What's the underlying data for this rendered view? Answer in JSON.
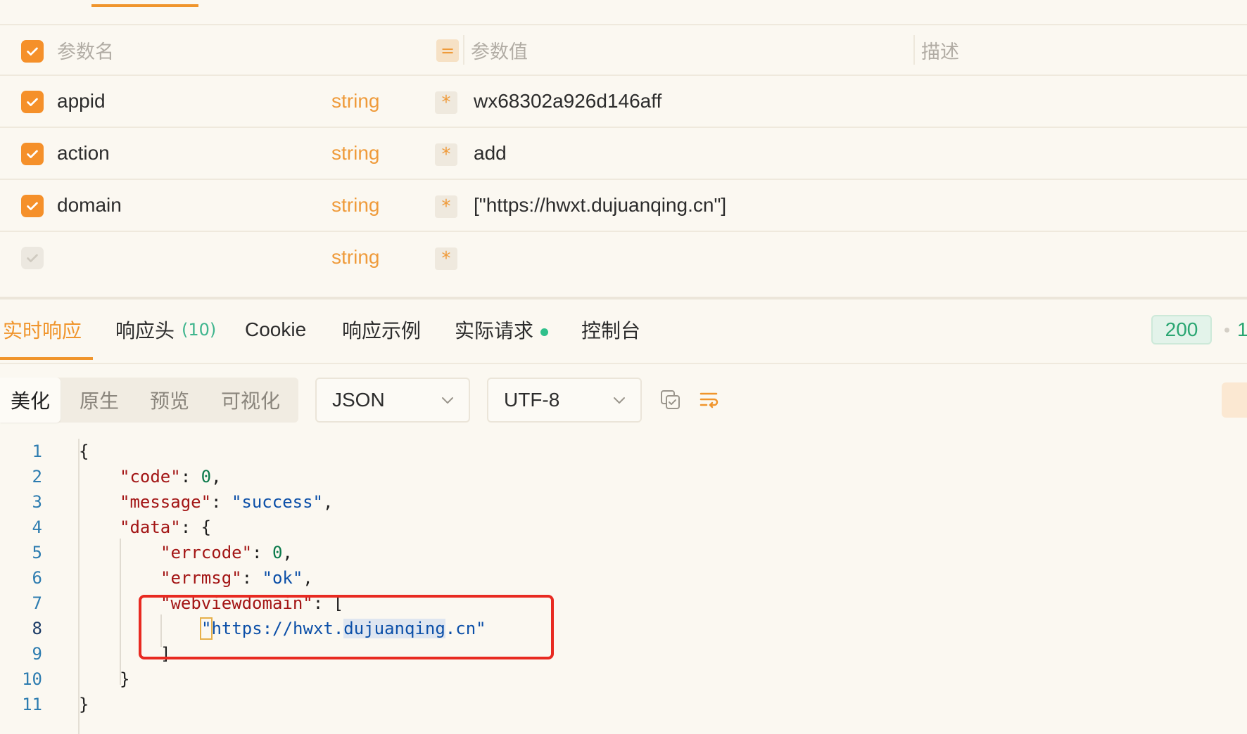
{
  "params": {
    "header": {
      "name": "参数名",
      "value": "参数值",
      "desc": "描述",
      "eq_symbol": "="
    },
    "rows": [
      {
        "name": "appid",
        "type": "string",
        "required": "*",
        "value": "wx68302a926d146aff",
        "checked": true
      },
      {
        "name": "action",
        "type": "string",
        "required": "*",
        "value": "add",
        "checked": true
      },
      {
        "name": "domain",
        "type": "string",
        "required": "*",
        "value": "[\"https://hwxt.dujuanqing.cn\"]",
        "checked": true
      },
      {
        "name": "",
        "type": "string",
        "required": "*",
        "value": "",
        "checked": false
      }
    ]
  },
  "response_tabs": {
    "realtime": "实时响应",
    "headers": "响应头",
    "headers_count": "(10)",
    "cookie": "Cookie",
    "example": "响应示例",
    "actual_request": "实际请求",
    "console": "控制台",
    "status_code": "200",
    "status_more": "1"
  },
  "toolbar": {
    "views": [
      "美化",
      "原生",
      "预览",
      "可视化"
    ],
    "active_view": "美化",
    "format": "JSON",
    "encoding": "UTF-8"
  },
  "editor": {
    "line_numbers": [
      "1",
      "2",
      "3",
      "4",
      "5",
      "6",
      "7",
      "8",
      "9",
      "10",
      "11"
    ],
    "current_line": "8",
    "json": {
      "code_key": "\"code\"",
      "code_val": "0",
      "message_key": "\"message\"",
      "message_val": "\"success\"",
      "data_key": "\"data\"",
      "errcode_key": "\"errcode\"",
      "errcode_val": "0",
      "errmsg_key": "\"errmsg\"",
      "errmsg_val": "\"ok\"",
      "webviewdomain_key": "\"webviewdomain\"",
      "url_open_quote": "\"",
      "url_part1": "https://hwxt.",
      "url_part2": "dujuanqing",
      "url_part3": ".cn\""
    }
  },
  "colors": {
    "accent": "#f0952c",
    "status_green": "#2aa672",
    "highlight_red": "#e82a21",
    "background": "#fbf8f1"
  }
}
